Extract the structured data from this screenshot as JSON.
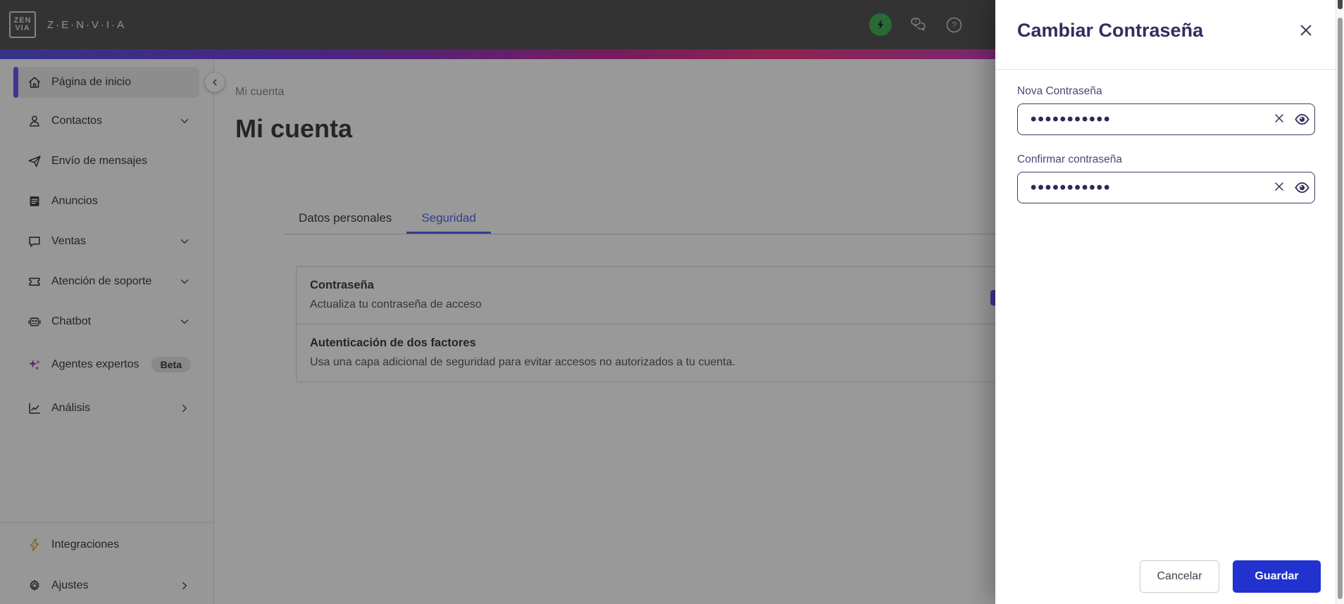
{
  "topbar": {
    "brand": "Z·E·N·V·I·A",
    "logo_line1": "ZEN",
    "logo_line2": "VIA"
  },
  "sidebar": {
    "items": [
      {
        "label": "Página de inicio"
      },
      {
        "label": "Contactos"
      },
      {
        "label": "Envío de mensajes"
      },
      {
        "label": "Anuncios"
      },
      {
        "label": "Ventas"
      },
      {
        "label": "Atención de soporte"
      },
      {
        "label": "Chatbot"
      },
      {
        "label": "Agentes expertos",
        "badge": "Beta"
      },
      {
        "label": "Análisis"
      }
    ],
    "footer_items": [
      {
        "label": "Integraciones"
      },
      {
        "label": "Ajustes"
      }
    ]
  },
  "main": {
    "breadcrumb": "Mi cuenta",
    "title": "Mi cuenta",
    "tabs": [
      {
        "label": "Datos personales"
      },
      {
        "label": "Seguridad"
      }
    ],
    "sections": [
      {
        "title": "Contraseña",
        "description": "Actualiza tu contraseña de acceso"
      },
      {
        "title": "Autenticación de dos factores",
        "description": "Usa una capa adicional de seguridad para evitar accesos no autorizados a tu cuenta."
      }
    ]
  },
  "drawer": {
    "title": "Cambiar Contraseña",
    "fields": [
      {
        "label": "Nova Contraseña",
        "value": "•••••••••••"
      },
      {
        "label": "Confirmar contraseña",
        "value": "•••••••••••"
      }
    ],
    "cancel_label": "Cancelar",
    "save_label": "Guardar"
  },
  "colors": {
    "accent_blue": "#2132cf",
    "active_tab_blue": "#5868f0",
    "selected_indicator_purple": "#6a5af0",
    "drawer_navy": "#312e5f",
    "status_green": "#45b159",
    "integrations_gold": "#d9ad3c",
    "gradient": [
      "#5a55e6",
      "#ef3a86",
      "#9b3fd6"
    ]
  }
}
